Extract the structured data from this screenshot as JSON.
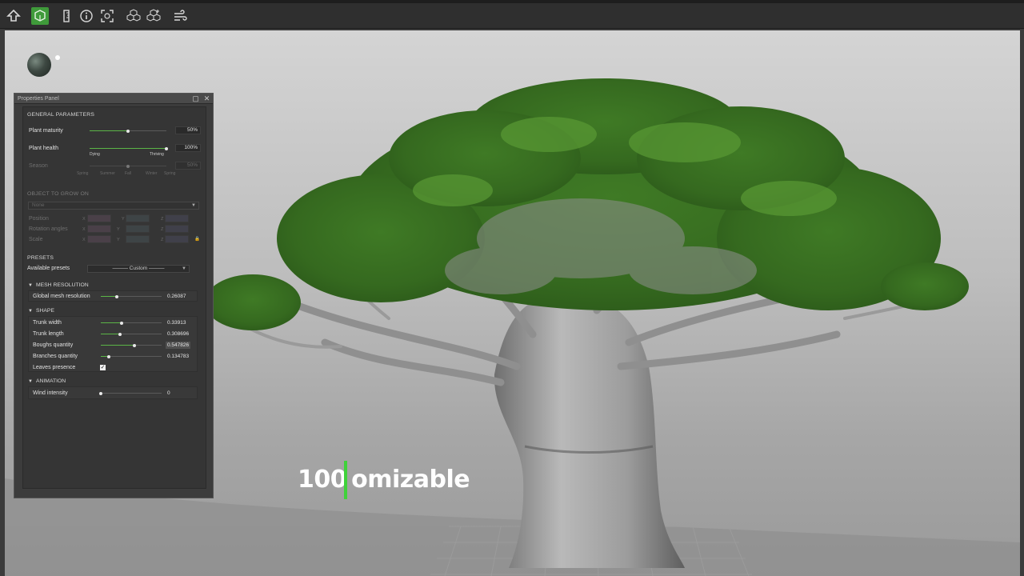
{
  "toolbar": {
    "icons": [
      "upload-icon",
      "plant-cube-icon",
      "ruler-icon",
      "info-icon",
      "focus-icon",
      "cubes-icon",
      "add-cubes-icon",
      "wind-icon"
    ]
  },
  "panel": {
    "title": "Properties Panel",
    "general": {
      "header": "GENERAL PARAMETERS",
      "maturity": {
        "label": "Plant maturity",
        "value": "50%",
        "level": 0.5
      },
      "health": {
        "label": "Plant health",
        "value": "100%",
        "level": 1.0,
        "min_label": "Dying",
        "max_label": "Thriving"
      },
      "season": {
        "label": "Season",
        "value": "50%",
        "level": 0.5,
        "ticks": [
          "Spring",
          "Summer",
          "Fall",
          "Winter",
          "Spring"
        ]
      }
    },
    "grow_on": {
      "header": "OBJECT TO GROW ON",
      "object": "None",
      "position_label": "Position",
      "rotation_label": "Rotation angles",
      "scale_label": "Scale",
      "axes": [
        "X",
        "Y",
        "Z"
      ]
    },
    "presets": {
      "header": "PRESETS",
      "available_label": "Available presets",
      "selected": "——— Custom ———"
    },
    "mesh": {
      "header": "MESH RESOLUTION",
      "global": {
        "label": "Global mesh resolution",
        "value": "0.26087",
        "level": 0.26
      }
    },
    "shape": {
      "header": "SHAPE",
      "rows": [
        {
          "label": "Trunk width",
          "value": "0.33913",
          "level": 0.34
        },
        {
          "label": "Trunk length",
          "value": "0.308696",
          "level": 0.31
        },
        {
          "label": "Boughs quantity",
          "value": "0.547826",
          "level": 0.55
        },
        {
          "label": "Branches quantity",
          "value": "0.134783",
          "level": 0.13
        }
      ],
      "leaves": {
        "label": "Leaves presence",
        "checked": true
      }
    },
    "animation": {
      "header": "ANIMATION",
      "wind": {
        "label": "Wind intensity",
        "value": "0",
        "level": 0.0
      }
    }
  },
  "caption": {
    "left": "100",
    "right": "omizable"
  },
  "colors": {
    "accent": "#3f9a3a",
    "slider_fill": "#5bb547",
    "caption_caret": "#3fd23a"
  }
}
